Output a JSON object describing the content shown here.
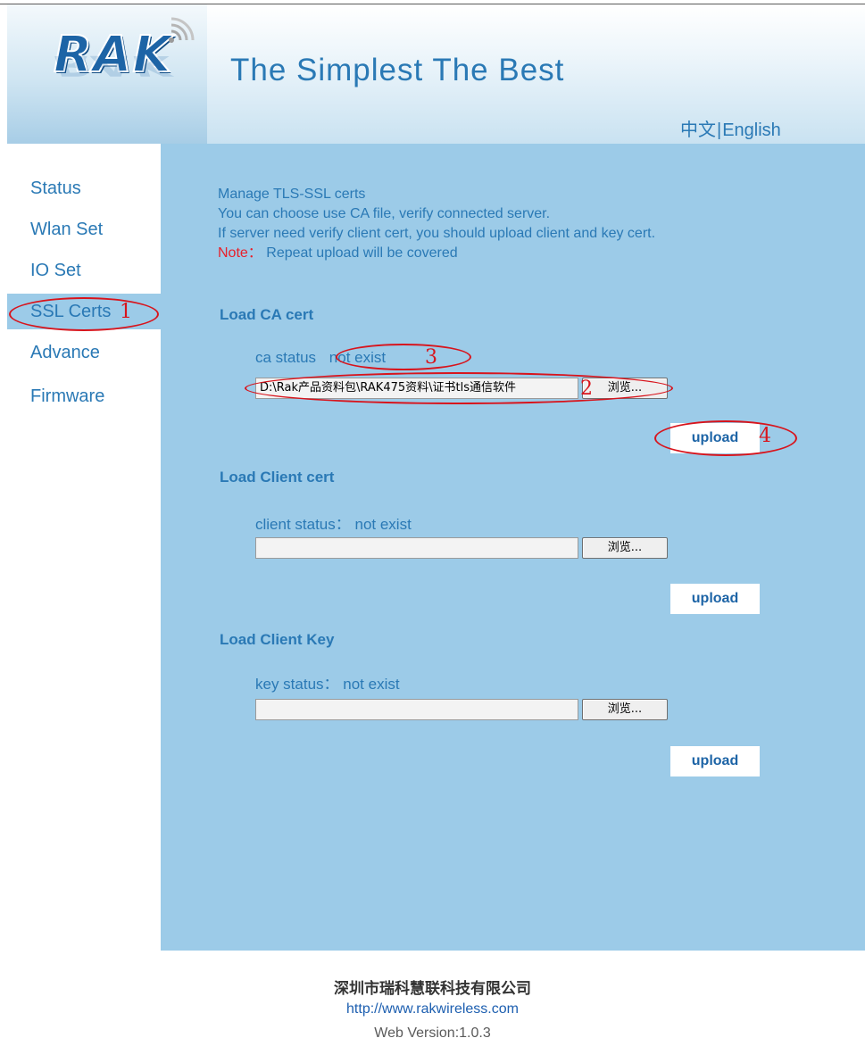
{
  "header": {
    "logo_text": "RAK",
    "slogan": "The  Simplest  The  Best",
    "lang_zh": "中文",
    "lang_sep": "|",
    "lang_en": "English"
  },
  "sidebar": {
    "items": [
      {
        "label": "Status",
        "active": false
      },
      {
        "label": "Wlan Set",
        "active": false
      },
      {
        "label": "IO Set",
        "active": false
      },
      {
        "label": "SSL Certs",
        "active": true
      },
      {
        "label": "Advance",
        "active": false
      },
      {
        "label": "Firmware",
        "active": false
      }
    ]
  },
  "main": {
    "intro": {
      "line1": "Manage TLS-SSL certs",
      "line2": "You can choose use CA file, verify connected server.",
      "line3": "If server need verify client cert, you should upload client and key cert.",
      "note_label": "Note：",
      "note_text": " Repeat upload will be covered"
    },
    "ca": {
      "title": "Load CA cert",
      "status_label": "ca status",
      "status_value": "not exist",
      "file_value": "D:\\Rak产品资料包\\RAK475资料\\证书tls通信软件",
      "browse_label": "浏览...",
      "upload_label": "upload"
    },
    "client_cert": {
      "title": "Load Client cert",
      "status_text": "client status：  not exist",
      "file_value": "",
      "browse_label": "浏览...",
      "upload_label": "upload"
    },
    "client_key": {
      "title": "Load Client Key",
      "status_text": "key status：  not exist",
      "file_value": "",
      "browse_label": "浏览...",
      "upload_label": "upload"
    }
  },
  "annotations": {
    "n1": "1",
    "n2": "2",
    "n3": "3",
    "n4": "4",
    "color": "#d8141c"
  },
  "footer": {
    "company": "深圳市瑞科慧联科技有限公司",
    "url": "http://www.rakwireless.com",
    "version": "Web Version:1.0.3"
  },
  "colors": {
    "accent_text": "#2a79b5",
    "panel_bg": "#9ccbe8",
    "note_red": "#e8202a"
  }
}
